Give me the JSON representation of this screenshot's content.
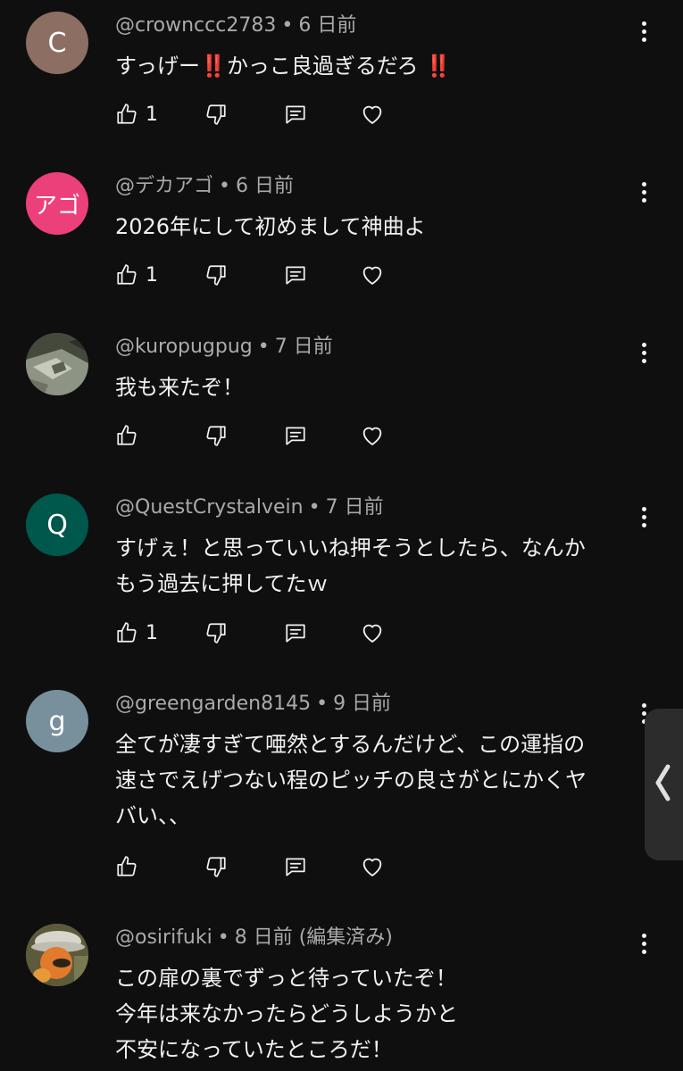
{
  "comments": [
    {
      "avatar_letter": "C",
      "avatar_color": "#8d6e63",
      "handle": "@crownccc2783",
      "separator": "•",
      "time": "6 日前",
      "text_parts": [
        "すっげー",
        "‼️",
        "かっこ良過ぎるだろ ",
        "‼️"
      ],
      "likes": "1"
    },
    {
      "avatar_letter": "アゴ",
      "avatar_color": "#ec407a",
      "handle": "@デカアゴ",
      "separator": "•",
      "time": "6 日前",
      "lines": [
        "2026年にして初めまして神曲よ"
      ],
      "likes": "1"
    },
    {
      "avatar_icon": "photo-avatar",
      "handle": "@kuropugpug",
      "separator": "•",
      "time": "7 日前",
      "lines": [
        "我も来たぞ！"
      ],
      "likes": ""
    },
    {
      "avatar_letter": "Q",
      "avatar_color": "#00574b",
      "handle": "@QuestCrystalvein",
      "separator": "•",
      "time": "7 日前",
      "lines": [
        "すげぇ！と思っていいね押そうとしたら、なんか",
        "もう過去に押してたｗ"
      ],
      "likes": "1"
    },
    {
      "avatar_letter": "g",
      "avatar_color": "#78909c",
      "handle": "@greengarden8145",
      "separator": "•",
      "time": "9 日前",
      "lines": [
        "全てが凄すぎて唖然とするんだけど、この運指の",
        "速さでえげつない程のピッチの良さがとにかくヤ",
        "バい、、"
      ],
      "likes": ""
    },
    {
      "avatar_icon": "photo-avatar",
      "handle": "@osirifuki",
      "separator": "•",
      "time": "8 日前 (編集済み)",
      "lines": [
        "この扉の裏でずっと待っていたぞ！",
        "今年は来なかったらどうしようかと",
        "不安になっていたところだ！"
      ],
      "likes": ""
    }
  ],
  "icons": {
    "like": "thumbs-up-icon",
    "dislike": "thumbs-down-icon",
    "reply": "reply-icon",
    "heart": "heart-icon",
    "more": "more-vert-icon",
    "side": "chevron-left-icon"
  },
  "colors": {
    "background": "#0f0f0f",
    "text": "#f1f1f1",
    "meta": "#aaaaaa",
    "accent_red": "#e0242a"
  }
}
